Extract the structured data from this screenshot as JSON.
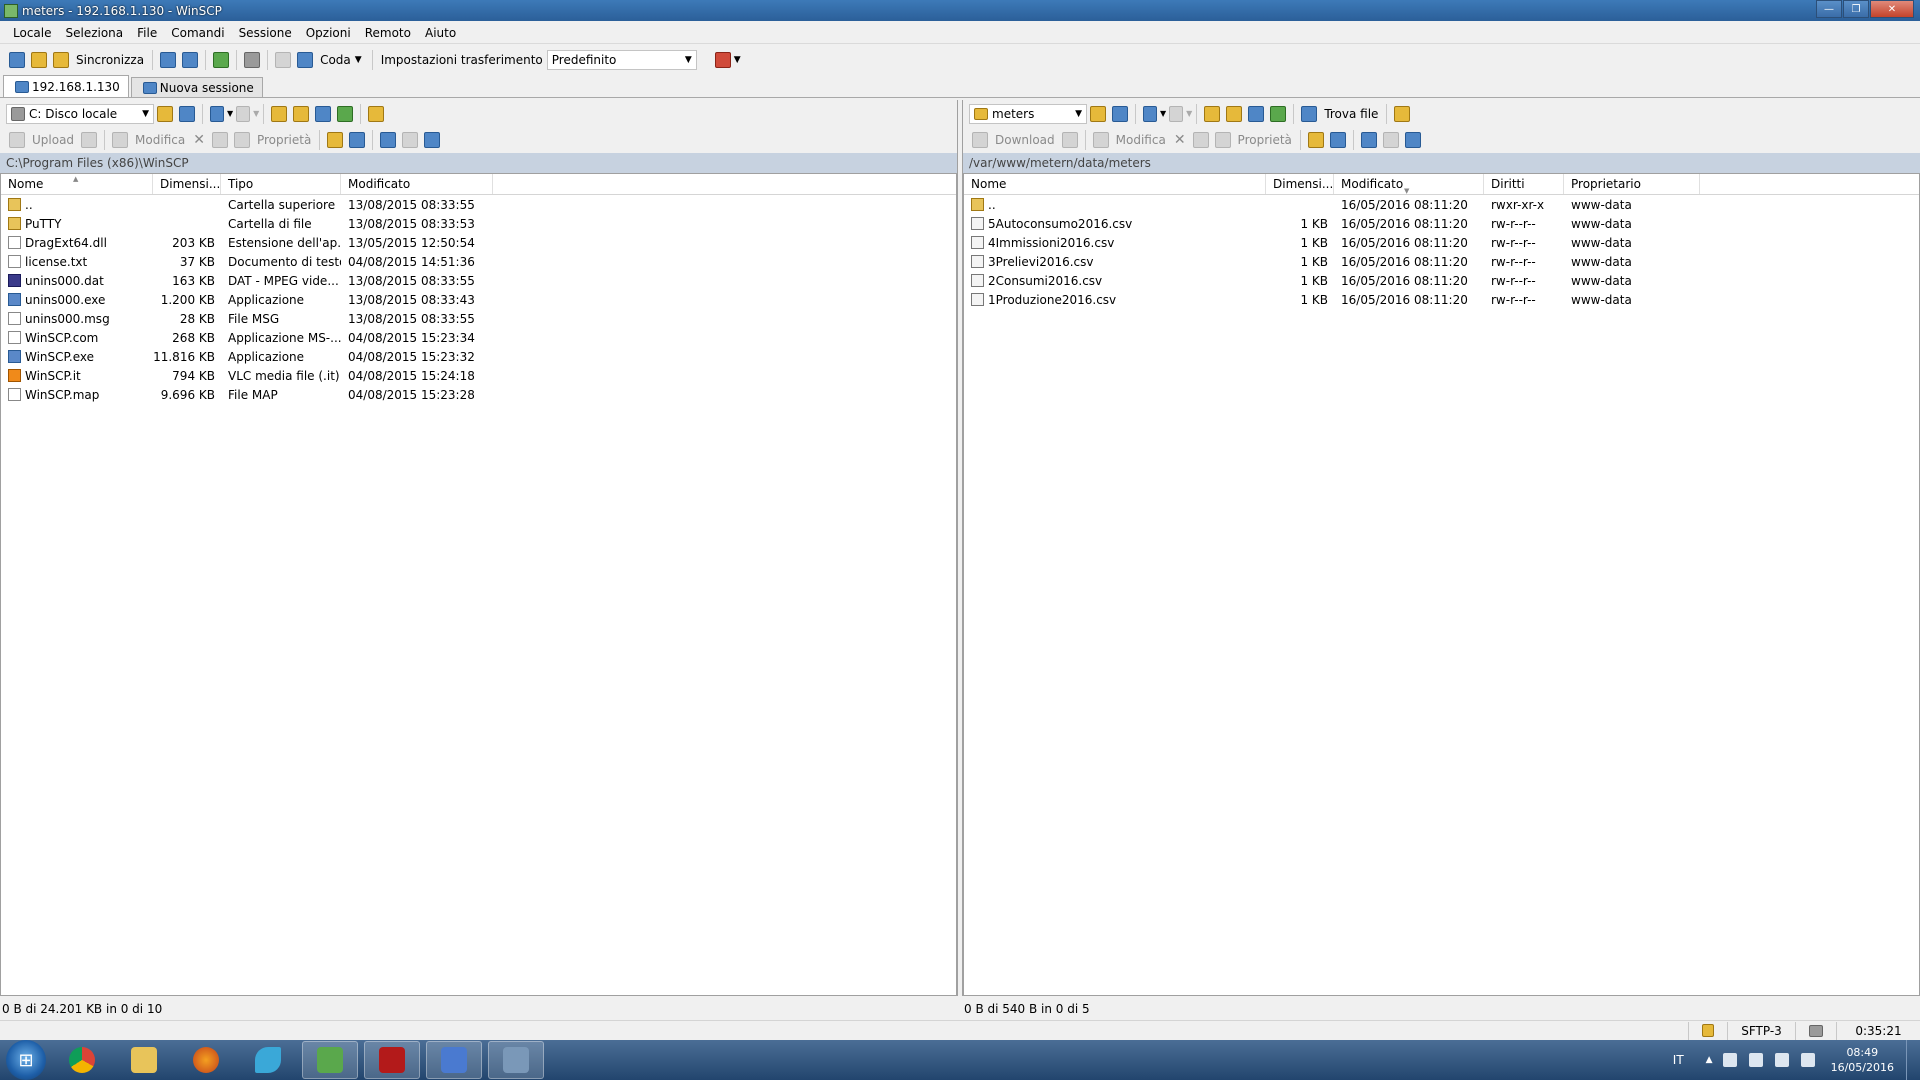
{
  "window": {
    "title": "meters - 192.168.1.130 - WinSCP"
  },
  "menu": [
    "Locale",
    "Seleziona",
    "File",
    "Comandi",
    "Sessione",
    "Opzioni",
    "Remoto",
    "Aiuto"
  ],
  "toolbar": {
    "sync_label": "Sincronizza",
    "queue_label": "Coda",
    "transfer_settings_label": "Impostazioni trasferimento",
    "transfer_preset": "Predefinito"
  },
  "tabs": [
    {
      "label": "192.168.1.130",
      "active": true
    },
    {
      "label": "Nuova sessione",
      "active": false
    }
  ],
  "left": {
    "drive": "C: Disco locale",
    "actions": {
      "upload": "Upload",
      "edit": "Modifica",
      "properties": "Proprietà"
    },
    "path": "C:\\Program Files (x86)\\WinSCP",
    "columns": [
      "Nome",
      "Dimensi...",
      "Tipo",
      "Modificato"
    ],
    "rows": [
      {
        "icon": "up",
        "name": "..",
        "size": "",
        "type": "Cartella superiore",
        "modified": "13/08/2015  08:33:55"
      },
      {
        "icon": "folder",
        "name": "PuTTY",
        "size": "",
        "type": "Cartella di file",
        "modified": "13/08/2015  08:33:53"
      },
      {
        "icon": "file",
        "name": "DragExt64.dll",
        "size": "203 KB",
        "type": "Estensione dell'ap...",
        "modified": "13/05/2015  12:50:54"
      },
      {
        "icon": "file",
        "name": "license.txt",
        "size": "37 KB",
        "type": "Documento di testo",
        "modified": "04/08/2015  14:51:36"
      },
      {
        "icon": "dat",
        "name": "unins000.dat",
        "size": "163 KB",
        "type": "DAT - MPEG vide...",
        "modified": "13/08/2015  08:33:55"
      },
      {
        "icon": "exe",
        "name": "unins000.exe",
        "size": "1.200 KB",
        "type": "Applicazione",
        "modified": "13/08/2015  08:33:43"
      },
      {
        "icon": "file",
        "name": "unins000.msg",
        "size": "28 KB",
        "type": "File MSG",
        "modified": "13/08/2015  08:33:55"
      },
      {
        "icon": "file",
        "name": "WinSCP.com",
        "size": "268 KB",
        "type": "Applicazione MS-...",
        "modified": "04/08/2015  15:23:34"
      },
      {
        "icon": "exe",
        "name": "WinSCP.exe",
        "size": "11.816 KB",
        "type": "Applicazione",
        "modified": "04/08/2015  15:23:32"
      },
      {
        "icon": "vlc",
        "name": "WinSCP.it",
        "size": "794 KB",
        "type": "VLC media file (.it)",
        "modified": "04/08/2015  15:24:18"
      },
      {
        "icon": "file",
        "name": "WinSCP.map",
        "size": "9.696 KB",
        "type": "File MAP",
        "modified": "04/08/2015  15:23:28"
      }
    ],
    "status": "0 B di 24.201 KB in 0 di 10"
  },
  "right": {
    "dir": "meters",
    "find_label": "Trova file",
    "actions": {
      "download": "Download",
      "edit": "Modifica",
      "properties": "Proprietà"
    },
    "path": "/var/www/metern/data/meters",
    "columns": [
      "Nome",
      "Dimensi...",
      "Modificato",
      "Diritti",
      "Proprietario"
    ],
    "rows": [
      {
        "icon": "up",
        "name": "..",
        "size": "",
        "modified": "16/05/2016 08:11:20",
        "rights": "rwxr-xr-x",
        "owner": "www-data"
      },
      {
        "icon": "csv",
        "name": "5Autoconsumo2016.csv",
        "size": "1 KB",
        "modified": "16/05/2016 08:11:20",
        "rights": "rw-r--r--",
        "owner": "www-data"
      },
      {
        "icon": "csv",
        "name": "4Immissioni2016.csv",
        "size": "1 KB",
        "modified": "16/05/2016 08:11:20",
        "rights": "rw-r--r--",
        "owner": "www-data"
      },
      {
        "icon": "csv",
        "name": "3Prelievi2016.csv",
        "size": "1 KB",
        "modified": "16/05/2016 08:11:20",
        "rights": "rw-r--r--",
        "owner": "www-data"
      },
      {
        "icon": "csv",
        "name": "2Consumi2016.csv",
        "size": "1 KB",
        "modified": "16/05/2016 08:11:20",
        "rights": "rw-r--r--",
        "owner": "www-data"
      },
      {
        "icon": "csv",
        "name": "1Produzione2016.csv",
        "size": "1 KB",
        "modified": "16/05/2016 08:11:20",
        "rights": "rw-r--r--",
        "owner": "www-data"
      }
    ],
    "status": "0 B di 540 B in 0 di 5"
  },
  "statusbar": {
    "protocol": "SFTP-3",
    "elapsed": "0:35:21"
  },
  "taskbar": {
    "apps": [
      "chrome-icon",
      "explorer-icon",
      "firefox-icon",
      "dolphin-icon",
      "monitor-icon",
      "acrobat-icon",
      "network-icon",
      "winscp-icon"
    ],
    "lang": "IT",
    "time": "08:49",
    "date": "16/05/2016"
  }
}
